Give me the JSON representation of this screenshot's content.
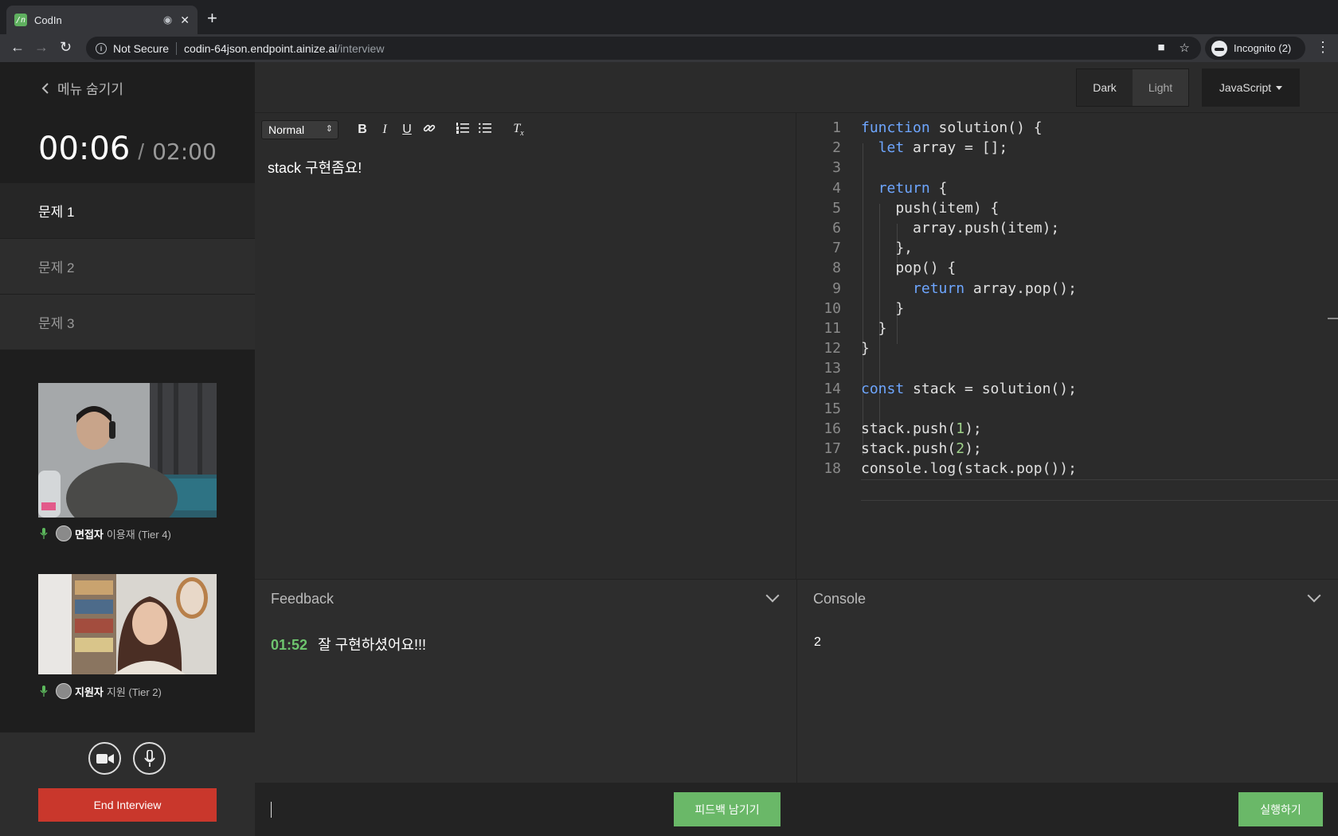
{
  "browser": {
    "tab_title": "CodIn",
    "favicon_text": "/n",
    "not_secure": "Not Secure",
    "url_host": "codin-64json.endpoint.ainize.ai",
    "url_path": "/interview",
    "profile_label": "Incognito (2)"
  },
  "sidebar": {
    "hide_menu": "메뉴 숨기기",
    "timer_elapsed": "00:06",
    "timer_separator": "/",
    "timer_total": "02:00",
    "problems": [
      {
        "label": "문제 1",
        "active": true
      },
      {
        "label": "문제 2",
        "active": false
      },
      {
        "label": "문제 3",
        "active": false
      }
    ],
    "participants": [
      {
        "role": "면접자",
        "name": "이용재 (Tier 4)"
      },
      {
        "role": "지원자",
        "name": "지원 (Tier 2)"
      }
    ],
    "end_button": "End Interview"
  },
  "topbar": {
    "theme_dark": "Dark",
    "theme_light": "Light",
    "language": "JavaScript"
  },
  "editor": {
    "format_select": "Normal",
    "text": "stack 구현좀요!"
  },
  "feedback": {
    "title": "Feedback",
    "entry_time": "01:52",
    "entry_text": "잘 구현하셨어요!!!"
  },
  "console": {
    "title": "Console",
    "output": "2"
  },
  "actions": {
    "feedback_button": "피드백 남기기",
    "run_button": "실행하기"
  },
  "colors": {
    "accent_green": "#6ab868",
    "danger_red": "#c9372c",
    "keyword_blue": "#6ea6ff"
  },
  "code_lines": [
    "function solution() {",
    "  let array = [];",
    "",
    "  return {",
    "    push(item) {",
    "      array.push(item);",
    "    },",
    "    pop() {",
    "      return array.pop();",
    "    }",
    "  }",
    "}",
    "",
    "const stack = solution();",
    "",
    "stack.push(1);",
    "stack.push(2);",
    "console.log(stack.pop());"
  ]
}
